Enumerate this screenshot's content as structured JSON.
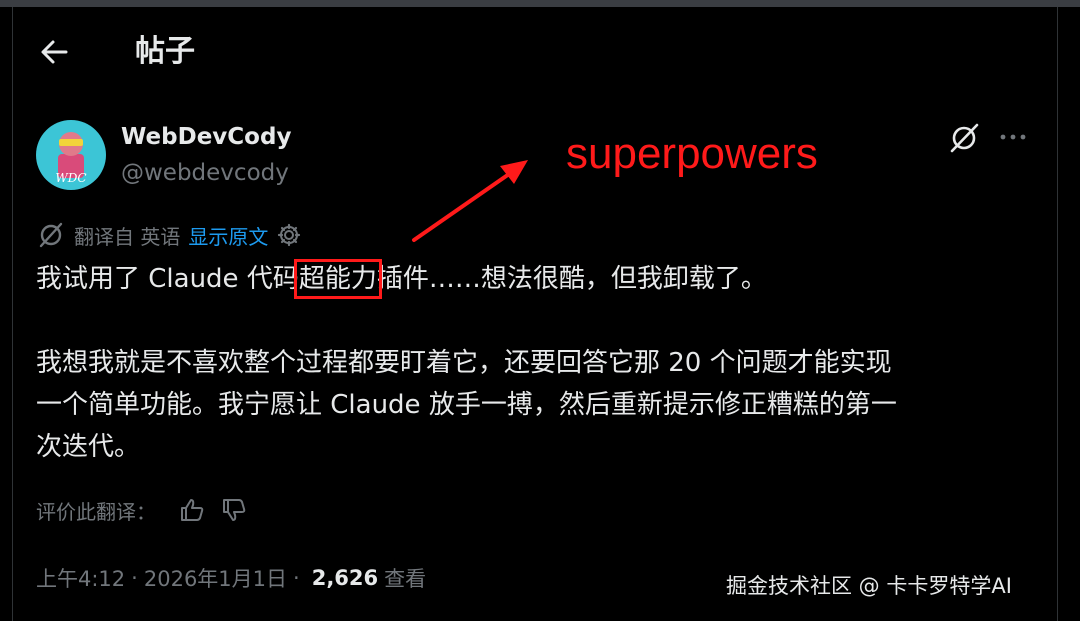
{
  "header": {
    "title": "帖子"
  },
  "author": {
    "display_name": "WebDevCody",
    "handle": "@webdevcody",
    "avatar_text": "WDC"
  },
  "annotation": {
    "label": "superpowers",
    "color": "#ff1a1a"
  },
  "translation": {
    "label": "翻译自 英语",
    "show_original": "显示原文"
  },
  "post": {
    "line1_before": "我试用了 Claude 代码",
    "line1_highlight": "超能力",
    "line1_after": "插件……想法很酷，但我卸载了。",
    "line2": "我想我就是不喜欢整个过程都要盯着它，还要回答它那 20 个问题才能实现",
    "line3": "一个简单功能。我宁愿让 Claude 放手一搏，然后重新提示修正糟糕的第一",
    "line4": "次迭代。"
  },
  "rating": {
    "label": "评价此翻译："
  },
  "meta": {
    "time": "上午4:12",
    "separator": "·",
    "date": "2026年1月1日",
    "views": "2,626",
    "views_label": "查看"
  },
  "watermark": "掘金技术社区 @ 卡卡罗特学AI",
  "colors": {
    "background": "#000000",
    "text": "#e7e9ea",
    "muted": "#71767b",
    "link": "#1d9bf0",
    "annotation": "#ff1a1a"
  },
  "icons": [
    "back-arrow-icon",
    "grok-icon",
    "more-icon",
    "translate-icon",
    "gear-icon",
    "thumbs-up-icon",
    "thumbs-down-icon"
  ]
}
